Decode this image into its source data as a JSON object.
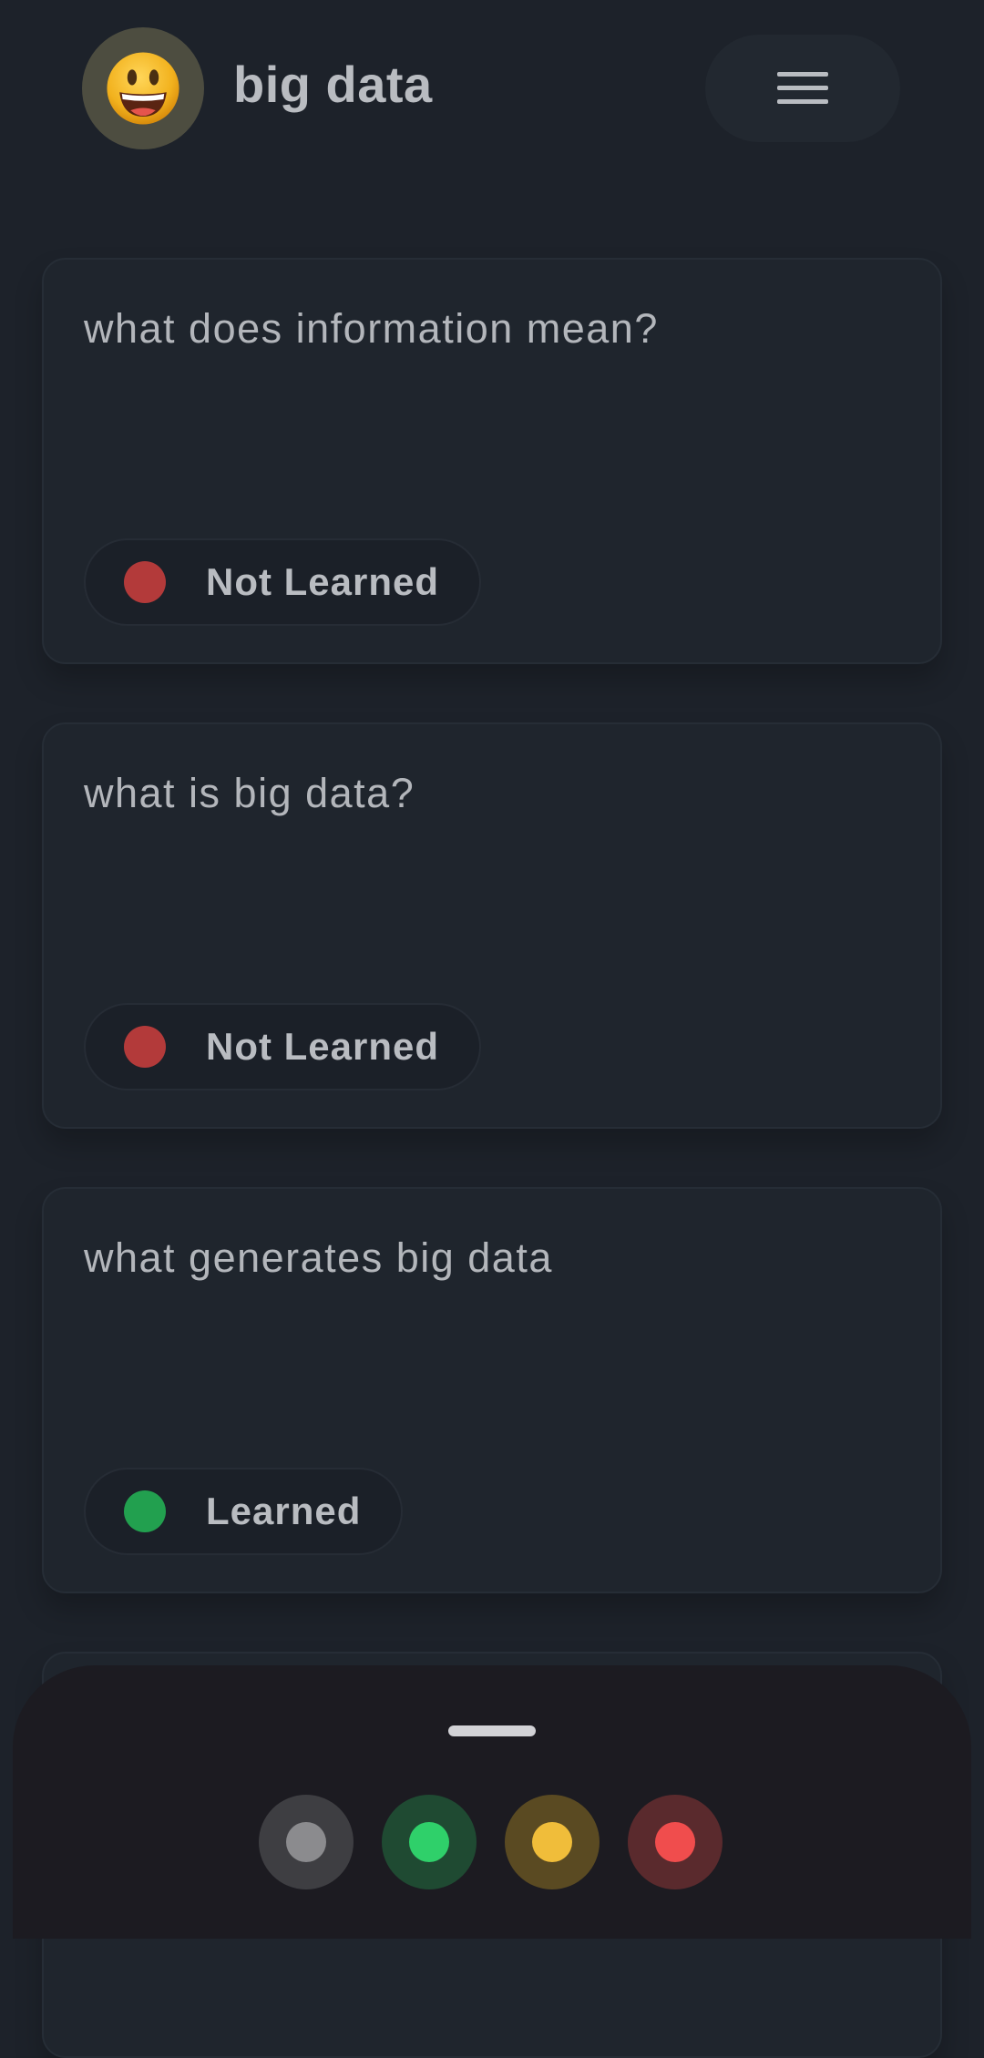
{
  "header": {
    "title": "big data",
    "avatar_emoji": "😃",
    "menu_icon": "hamburger-menu-icon"
  },
  "cards": [
    {
      "question": "what does information mean?",
      "status": "Not Learned",
      "status_color": "#b33a3a"
    },
    {
      "question": "what is big data?",
      "status": "Not Learned",
      "status_color": "#b33a3a"
    },
    {
      "question": "what generates big data",
      "status": "Learned",
      "status_color": "#22a04f"
    }
  ],
  "filters": [
    {
      "name": "all",
      "bg": "#3e3e42",
      "dot": "#8b8b8e"
    },
    {
      "name": "learned",
      "bg": "#1f4a32",
      "dot": "#2fd06a"
    },
    {
      "name": "in-progress",
      "bg": "#5a4a22",
      "dot": "#f0bd3a"
    },
    {
      "name": "not-learned",
      "bg": "#5a2a2d",
      "dot": "#f04d4d"
    }
  ]
}
